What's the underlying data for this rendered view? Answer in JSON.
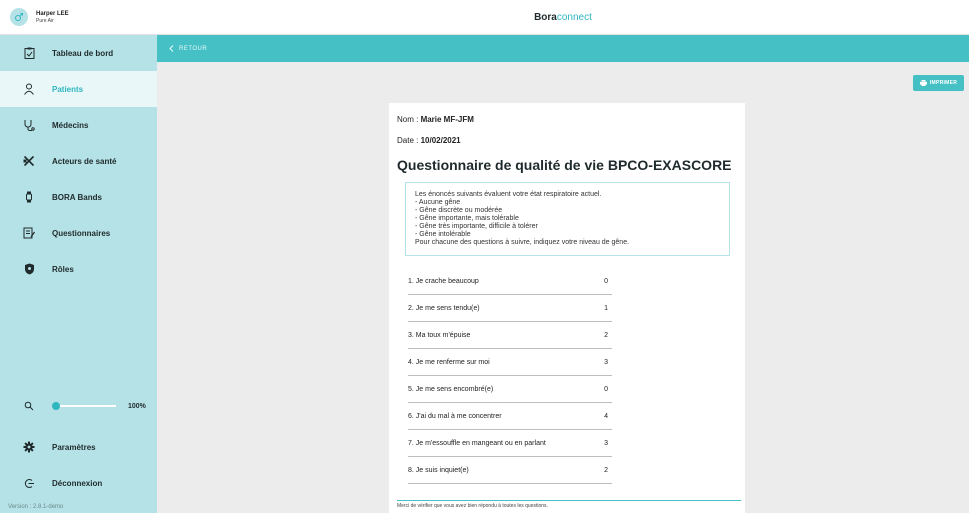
{
  "user": {
    "name": "Harper LEE",
    "subtitle": "Pure Air"
  },
  "brand": {
    "part1": "Bora",
    "part2": "connect"
  },
  "sidebar": {
    "items": [
      {
        "label": "Tableau de bord",
        "icon": "clipboard-icon"
      },
      {
        "label": "Patients",
        "icon": "person-icon",
        "active": true
      },
      {
        "label": "Médecins",
        "icon": "stethoscope-icon"
      },
      {
        "label": "Acteurs de santé",
        "icon": "tools-icon"
      },
      {
        "label": "BORA Bands",
        "icon": "band-icon"
      },
      {
        "label": "Questionnaires",
        "icon": "form-icon"
      },
      {
        "label": "Rôles",
        "icon": "shield-icon"
      }
    ],
    "zoom": {
      "value": "100%",
      "level": 0.0
    },
    "settings_label": "Paramètres",
    "logout_label": "Déconnexion",
    "version": "Version : 2.8.1-demo"
  },
  "toolbar": {
    "back_label": "RETOUR",
    "print_label": "IMPRIMER"
  },
  "questionnaire": {
    "name_label": "Nom : ",
    "name_value": "Marie MF-JFM",
    "date_label": "Date : ",
    "date_value": "10/02/2021",
    "title": "Questionnaire de qualité de vie BPCO-EXASCORE",
    "instructions": [
      "Les énoncés suivants évaluent votre état respiratoire actuel.",
      "- Aucune gêne",
      "- Gêne discrète ou modérée",
      "- Gêne importante, mais tolérable",
      "- Gêne très importante, difficile à tolérer",
      "- Gêne intolérable",
      "Pour chacune des questions à suivre, indiquez votre niveau de gêne."
    ],
    "rows": [
      {
        "q": "1. Je crache beaucoup",
        "v": "0"
      },
      {
        "q": "2. Je me sens tendu(e)",
        "v": "1"
      },
      {
        "q": "3. Ma toux m'épuise",
        "v": "2"
      },
      {
        "q": "4. Je me renferme sur moi",
        "v": "3"
      },
      {
        "q": "5. Je me sens encombré(e)",
        "v": "0"
      },
      {
        "q": "6. J'ai du mal à me concentrer",
        "v": "4"
      },
      {
        "q": "7. Je m'essouffle en mangeant ou en parlant",
        "v": "3"
      },
      {
        "q": "8. Je suis inquiet(e)",
        "v": "2"
      }
    ],
    "footnote": "Merci de vérifier que vous avez bien répondu à toutes les questions."
  },
  "colors": {
    "accent": "#45c1c6",
    "sidebar_bg": "#b5e2e6",
    "active_text": "#2fb6bf"
  }
}
